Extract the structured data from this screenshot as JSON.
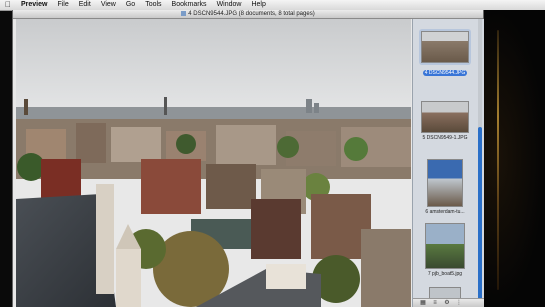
{
  "menubar": {
    "app": "Preview",
    "items": [
      "File",
      "Edit",
      "View",
      "Go",
      "Tools",
      "Bookmarks",
      "Window",
      "Help"
    ]
  },
  "window": {
    "title": "4 DSCN9544.JPG (8 documents, 8 total pages)"
  },
  "sidebar": {
    "thumbnails": [
      {
        "caption": "4 DSCN9544.JPG",
        "selected": true
      },
      {
        "caption": "5 DSCN9549-1.JPG",
        "selected": false
      },
      {
        "caption": "6 amsterdam-tu...",
        "selected": false
      },
      {
        "caption": "7 pjb_boat5.jpg",
        "selected": false
      }
    ]
  },
  "colors": {
    "selection": "#3875d7",
    "sidebar_bg": "#d4d9e0",
    "scroll_thumb": "#2a6fc8"
  }
}
